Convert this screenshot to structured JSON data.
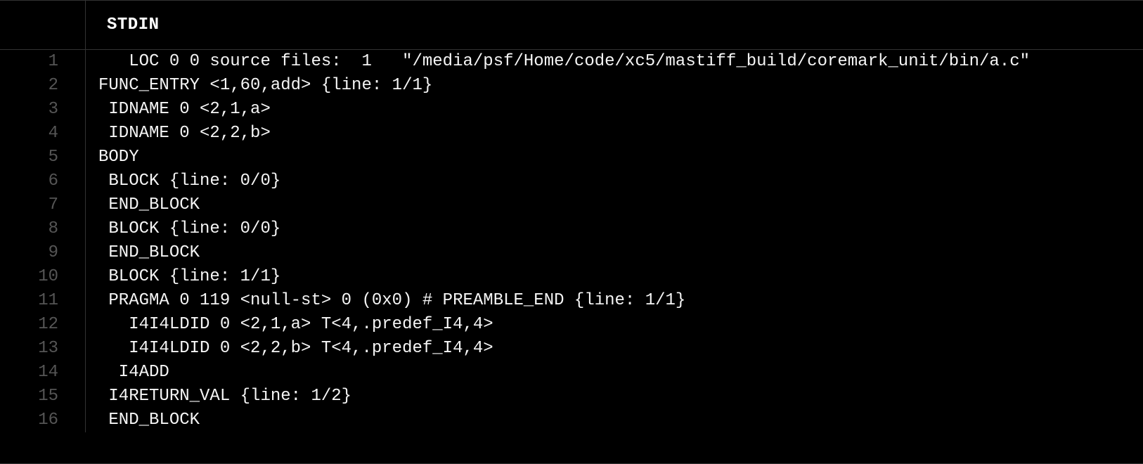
{
  "header": {
    "title": "STDIN"
  },
  "lines": [
    {
      "n": "1",
      "t": "   LOC 0 0 source files:  1   \"/media/psf/Home/code/xc5/mastiff_build/coremark_unit/bin/a.c\""
    },
    {
      "n": "2",
      "t": "FUNC_ENTRY <1,60,add> {line: 1/1}"
    },
    {
      "n": "3",
      "t": " IDNAME 0 <2,1,a>"
    },
    {
      "n": "4",
      "t": " IDNAME 0 <2,2,b>"
    },
    {
      "n": "5",
      "t": "BODY"
    },
    {
      "n": "6",
      "t": " BLOCK {line: 0/0}"
    },
    {
      "n": "7",
      "t": " END_BLOCK"
    },
    {
      "n": "8",
      "t": " BLOCK {line: 0/0}"
    },
    {
      "n": "9",
      "t": " END_BLOCK"
    },
    {
      "n": "10",
      "t": " BLOCK {line: 1/1}"
    },
    {
      "n": "11",
      "t": " PRAGMA 0 119 <null-st> 0 (0x0) # PREAMBLE_END {line: 1/1}"
    },
    {
      "n": "12",
      "t": "   I4I4LDID 0 <2,1,a> T<4,.predef_I4,4>"
    },
    {
      "n": "13",
      "t": "   I4I4LDID 0 <2,2,b> T<4,.predef_I4,4>"
    },
    {
      "n": "14",
      "t": "  I4ADD"
    },
    {
      "n": "15",
      "t": " I4RETURN_VAL {line: 1/2}"
    },
    {
      "n": "16",
      "t": " END_BLOCK"
    }
  ]
}
